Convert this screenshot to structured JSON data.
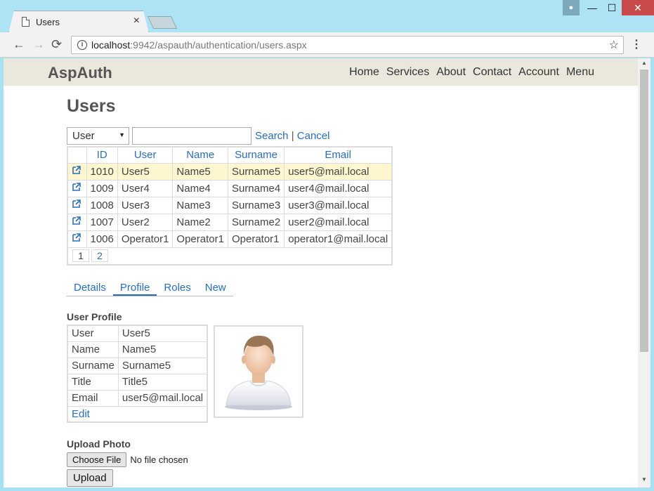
{
  "browser": {
    "tab_title": "Users",
    "tab_close": "×",
    "url_host": "localhost",
    "url_rest": ":9942/aspauth/authentication/users.aspx",
    "back": "←",
    "forward": "→",
    "reload": "⟳",
    "star": "☆",
    "menu": "⋮",
    "min": "—",
    "max": "☐",
    "close": "✕"
  },
  "site": {
    "brand": "AspAuth",
    "nav": [
      "Home",
      "Services",
      "About",
      "Contact",
      "Account",
      "Menu"
    ]
  },
  "page": {
    "title": "Users",
    "search": {
      "field_value": "User",
      "text_value": "",
      "search_label": "Search",
      "separator": "|",
      "cancel_label": "Cancel"
    },
    "grid": {
      "headers": [
        "ID",
        "User",
        "Name",
        "Surname",
        "Email"
      ],
      "rows": [
        {
          "id": "1010",
          "user": "User5",
          "name": "Name5",
          "surname": "Surname5",
          "email": "user5@mail.local",
          "selected": true
        },
        {
          "id": "1009",
          "user": "User4",
          "name": "Name4",
          "surname": "Surname4",
          "email": "user4@mail.local"
        },
        {
          "id": "1008",
          "user": "User3",
          "name": "Name3",
          "surname": "Surname3",
          "email": "user3@mail.local"
        },
        {
          "id": "1007",
          "user": "User2",
          "name": "Name2",
          "surname": "Surname2",
          "email": "user2@mail.local"
        },
        {
          "id": "1006",
          "user": "Operator1",
          "name": "Operator1",
          "surname": "Operator1",
          "email": "operator1@mail.local"
        }
      ],
      "pages": [
        "1",
        "2"
      ]
    },
    "tabs": [
      "Details",
      "Profile",
      "Roles",
      "New"
    ],
    "active_tab": "Profile",
    "profile": {
      "heading": "User Profile",
      "rows": [
        {
          "key": "User",
          "value": "User5"
        },
        {
          "key": "Name",
          "value": "Name5"
        },
        {
          "key": "Surname",
          "value": "Surname5"
        },
        {
          "key": "Title",
          "value": "Title5"
        },
        {
          "key": "Email",
          "value": "user5@mail.local"
        }
      ],
      "edit_label": "Edit"
    },
    "upload": {
      "heading": "Upload Photo",
      "choose_label": "Choose File",
      "no_file": "No file chosen",
      "upload_label": "Upload"
    }
  },
  "colors": {
    "link": "#2a6ebb",
    "selected_row": "#fdf6cf",
    "header_bg": "#eae7dd"
  }
}
